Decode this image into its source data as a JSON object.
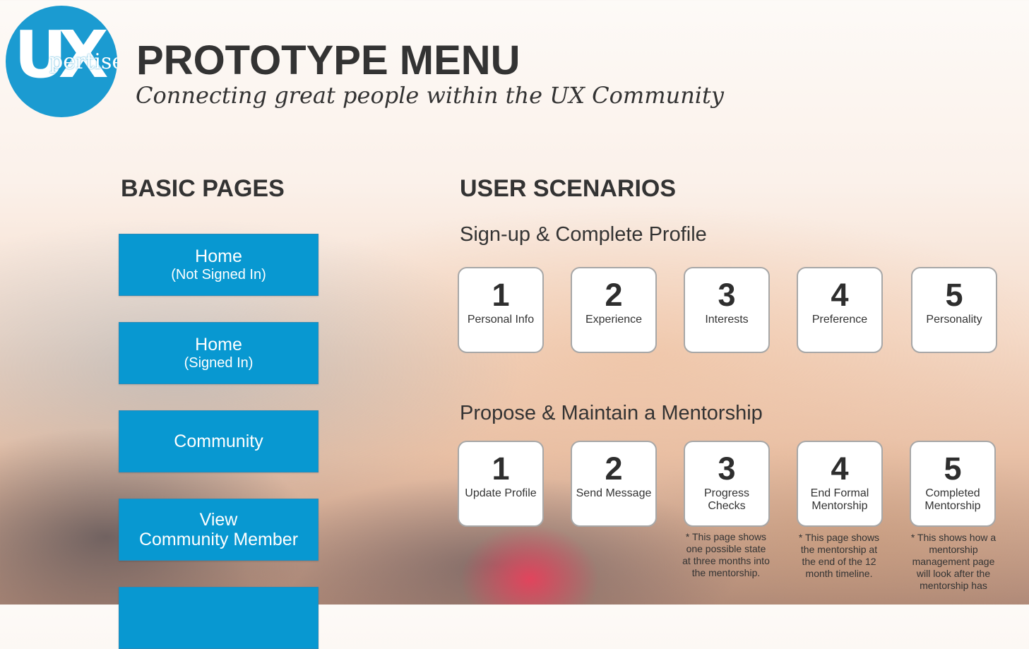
{
  "logo": {
    "mark": "UX",
    "sub": "pertise"
  },
  "header": {
    "title": "PROTOTYPE MENU",
    "tagline": "Connecting great people within the UX Community"
  },
  "basic_pages": {
    "heading": "BASIC PAGES",
    "buttons": [
      {
        "main": "Home",
        "sub": "(Not Signed In)"
      },
      {
        "main": "Home",
        "sub": "(Signed In)"
      },
      {
        "main": "Community",
        "sub": ""
      },
      {
        "main": "View",
        "sub": "Community Member"
      }
    ]
  },
  "user_scenarios": {
    "heading": "USER SCENARIOS",
    "signup": {
      "title": "Sign-up & Complete Profile",
      "steps": [
        {
          "num": "1",
          "label": "Personal Info"
        },
        {
          "num": "2",
          "label": "Experience"
        },
        {
          "num": "3",
          "label": "Interests"
        },
        {
          "num": "4",
          "label": "Preference"
        },
        {
          "num": "5",
          "label": "Personality"
        }
      ]
    },
    "mentorship": {
      "title": "Propose & Maintain a Mentorship",
      "steps": [
        {
          "num": "1",
          "label": "Update Profile"
        },
        {
          "num": "2",
          "label": "Send Message"
        },
        {
          "num": "3",
          "label": "Progress Checks"
        },
        {
          "num": "4",
          "label": "End Formal Mentorship"
        },
        {
          "num": "5",
          "label": "Completed Mentorship"
        }
      ],
      "notes": [
        "* This page shows one possible state at three months into the mentorship.",
        "* This page shows the mentorship at the end of the 12 month timeline.",
        "* This shows how a mentorship management page will look after the mentorship has"
      ]
    }
  }
}
